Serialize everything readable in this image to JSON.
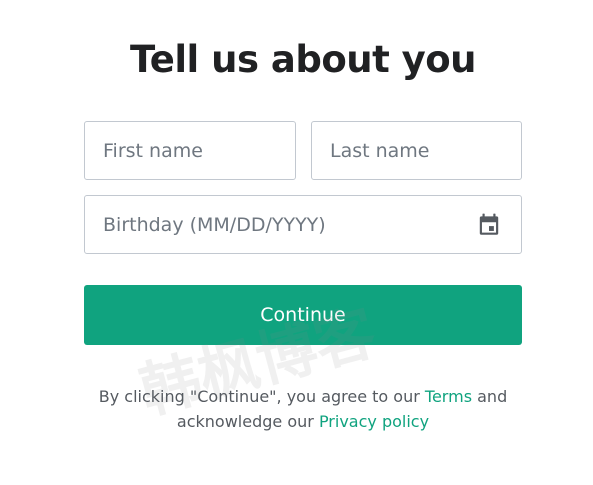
{
  "form": {
    "title": "Tell us about you",
    "first_name_placeholder": "First name",
    "last_name_placeholder": "Last name",
    "birthday_placeholder": "Birthday (MM/DD/YYYY)",
    "continue_label": "Continue"
  },
  "legal": {
    "prefix": "By clicking \"Continue\", you agree to our ",
    "terms_label": "Terms",
    "middle": " and acknowledge our ",
    "privacy_label": "Privacy policy"
  },
  "watermark": {
    "text": "韩枫博客"
  },
  "colors": {
    "accent": "#10a37f",
    "title": "#202123",
    "border": "#c2c8d0",
    "placeholder": "#6f7780",
    "body_text": "#555a60"
  },
  "icons": {
    "birthday_picker": "calendar-icon"
  }
}
